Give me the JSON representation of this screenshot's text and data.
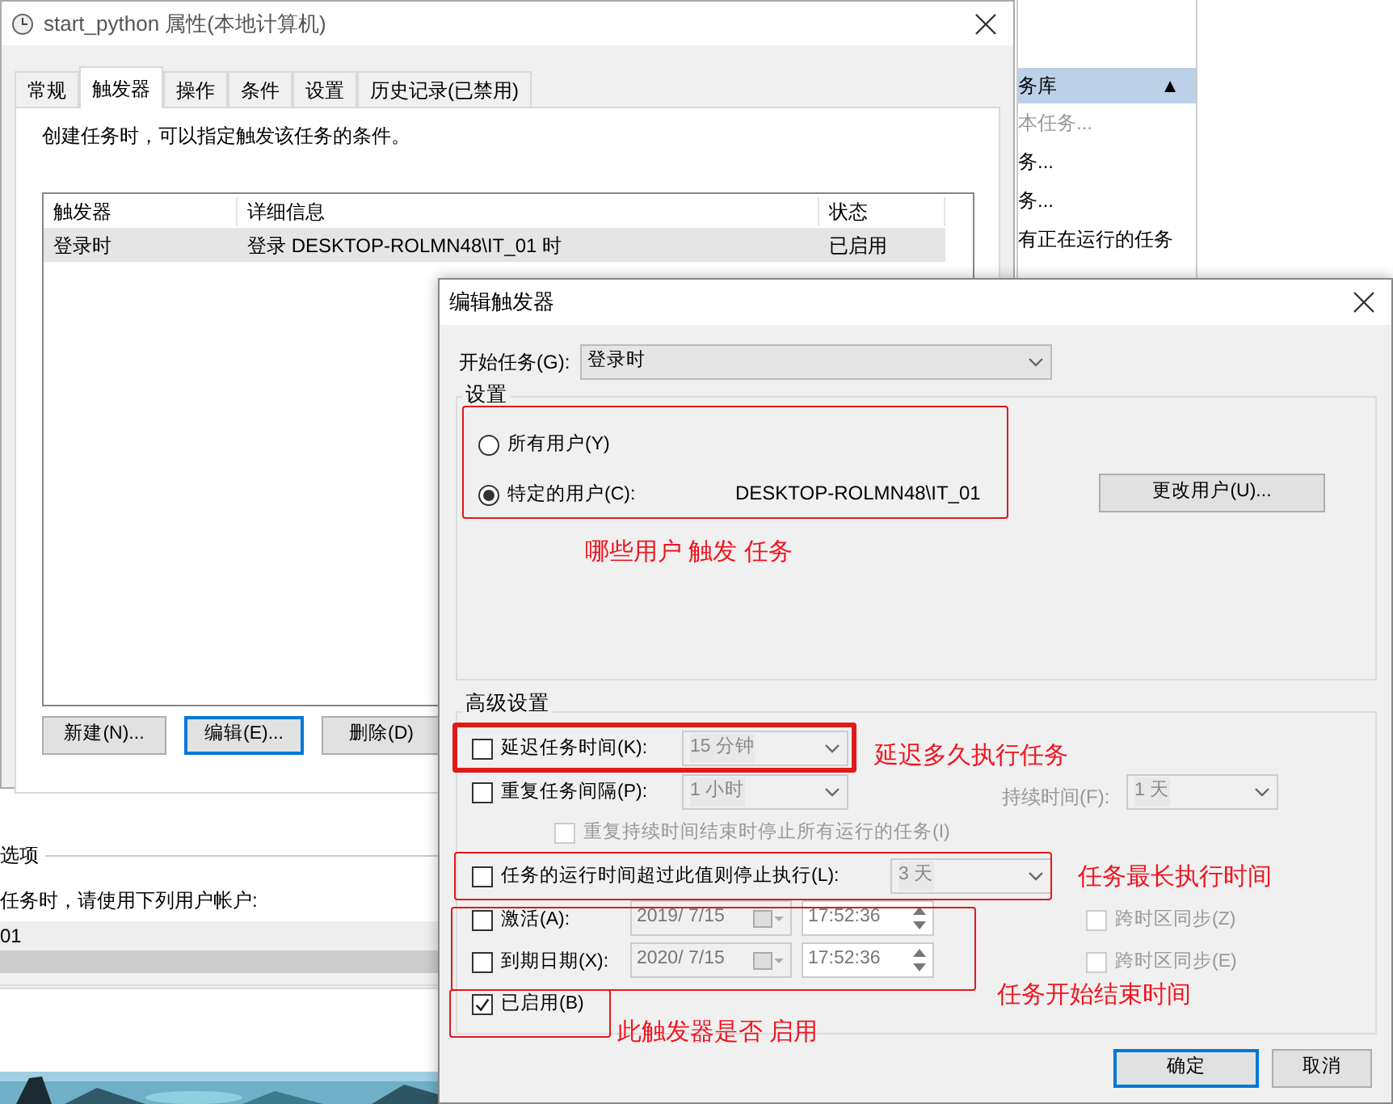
{
  "properties_window": {
    "title": "start_python 属性(本地计算机)",
    "tabs": [
      {
        "label": "常规",
        "selected": false
      },
      {
        "label": "触发器",
        "selected": true
      },
      {
        "label": "操作",
        "selected": false
      },
      {
        "label": "条件",
        "selected": false
      },
      {
        "label": "设置",
        "selected": false
      },
      {
        "label": "历史记录(已禁用)",
        "selected": false
      }
    ],
    "description": "创建任务时，可以指定触发该任务的条件。",
    "table": {
      "columns": [
        "触发器",
        "详细信息",
        "状态"
      ],
      "rows": [
        {
          "cells": [
            "登录时",
            "登录 DESKTOP-ROLMN48\\IT_01 时",
            "已启用"
          ],
          "selected": true
        }
      ]
    },
    "buttons": [
      {
        "label": "新建(N)...",
        "focused": false
      },
      {
        "label": "编辑(E)...",
        "focused": true
      },
      {
        "label": "删除(D)",
        "focused": false
      }
    ]
  },
  "side_panel": {
    "header": "务库",
    "header_glyph": "▲",
    "items": [
      {
        "label": "本任务...",
        "disabled": true
      },
      {
        "label": "务...",
        "disabled": false
      },
      {
        "label": "务...",
        "disabled": false
      },
      {
        "label": "有正在运行的任务",
        "disabled": false
      }
    ]
  },
  "security_section": {
    "heading": "选项",
    "text": "任务时，请使用下列用户帐户:",
    "account": "01"
  },
  "edit_dialog": {
    "title": "编辑触发器",
    "start_label": "开始任务(G):",
    "start_value": "登录时",
    "settings": {
      "heading": "设置",
      "radios": [
        {
          "label": "所有用户(Y)",
          "selected": false
        },
        {
          "label": "特定的用户(C):",
          "selected": true
        }
      ],
      "user": "DESKTOP-ROLMN48\\IT_01",
      "change_button": "更改用户(U)..."
    },
    "advanced": {
      "heading": "高级设置",
      "delay": {
        "label": "延迟任务时间(K):",
        "checked": false,
        "value": "15 分钟"
      },
      "repeat": {
        "label": "重复任务间隔(P):",
        "checked": false,
        "value": "1 小时",
        "duration_label": "持续时间(F):",
        "duration_value": "1 天"
      },
      "stop_all": {
        "label": "重复持续时间结束时停止所有运行的任务(I)",
        "checked": false,
        "disabled": true
      },
      "stop_after": {
        "label": "任务的运行时间超过此值则停止执行(L):",
        "checked": false,
        "value": "3 天"
      },
      "activate": {
        "label": "激活(A):",
        "checked": false,
        "date": "2019/  7/15",
        "time": "17:52:36",
        "sync_label": "跨时区同步(Z)",
        "sync_checked": false
      },
      "expire": {
        "label": "到期日期(X):",
        "checked": false,
        "date": "2020/  7/15",
        "time": "17:52:36",
        "sync_label": "跨时区同步(E)",
        "sync_checked": false
      },
      "enabled": {
        "label": "已启用(B)",
        "checked": true
      }
    },
    "buttons": [
      {
        "label": "确定",
        "focused": true
      },
      {
        "label": "取消",
        "focused": false
      }
    ]
  },
  "annotations": [
    {
      "text": "哪些用户 触发 任务"
    },
    {
      "text": "延迟多久执行任务"
    },
    {
      "text": "任务最长执行时间"
    },
    {
      "text": "任务开始结束时间"
    },
    {
      "text": "此触发器是否 启用"
    }
  ]
}
